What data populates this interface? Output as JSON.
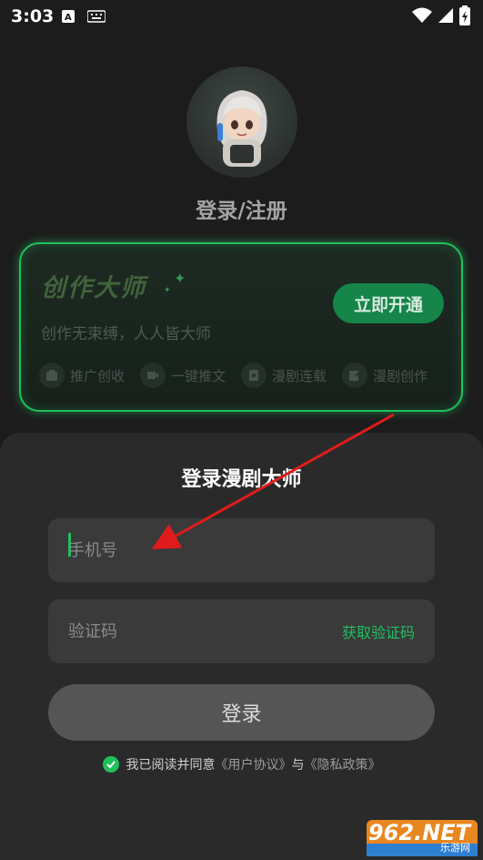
{
  "status_bar": {
    "time": "3:03"
  },
  "header": {
    "title": "登录/注册"
  },
  "vip_card": {
    "title": "创作大师",
    "subtitle": "创作无束缚，人人皆大师",
    "button_label": "立即开通",
    "features": [
      {
        "label": "推广创收",
        "icon": "promo-icon"
      },
      {
        "label": "一键推文",
        "icon": "video-icon"
      },
      {
        "label": "漫剧连载",
        "icon": "serial-icon"
      },
      {
        "label": "漫剧创作",
        "icon": "edit-icon"
      }
    ]
  },
  "login_sheet": {
    "title": "登录漫剧大师",
    "phone_placeholder": "手机号",
    "code_placeholder": "验证码",
    "get_code_label": "获取验证码",
    "login_button": "登录",
    "agreement_prefix": "我已阅读并同意",
    "user_agreement": "《用户协议》",
    "and_text": "与",
    "privacy_policy": "《隐私政策》"
  },
  "watermark": {
    "text": "962.NET",
    "sub": "乐游网"
  },
  "colors": {
    "accent": "#1fc05e",
    "background": "#1c1c1c",
    "sheet": "#2a2a2a",
    "annotation_arrow": "#e01b1b"
  }
}
